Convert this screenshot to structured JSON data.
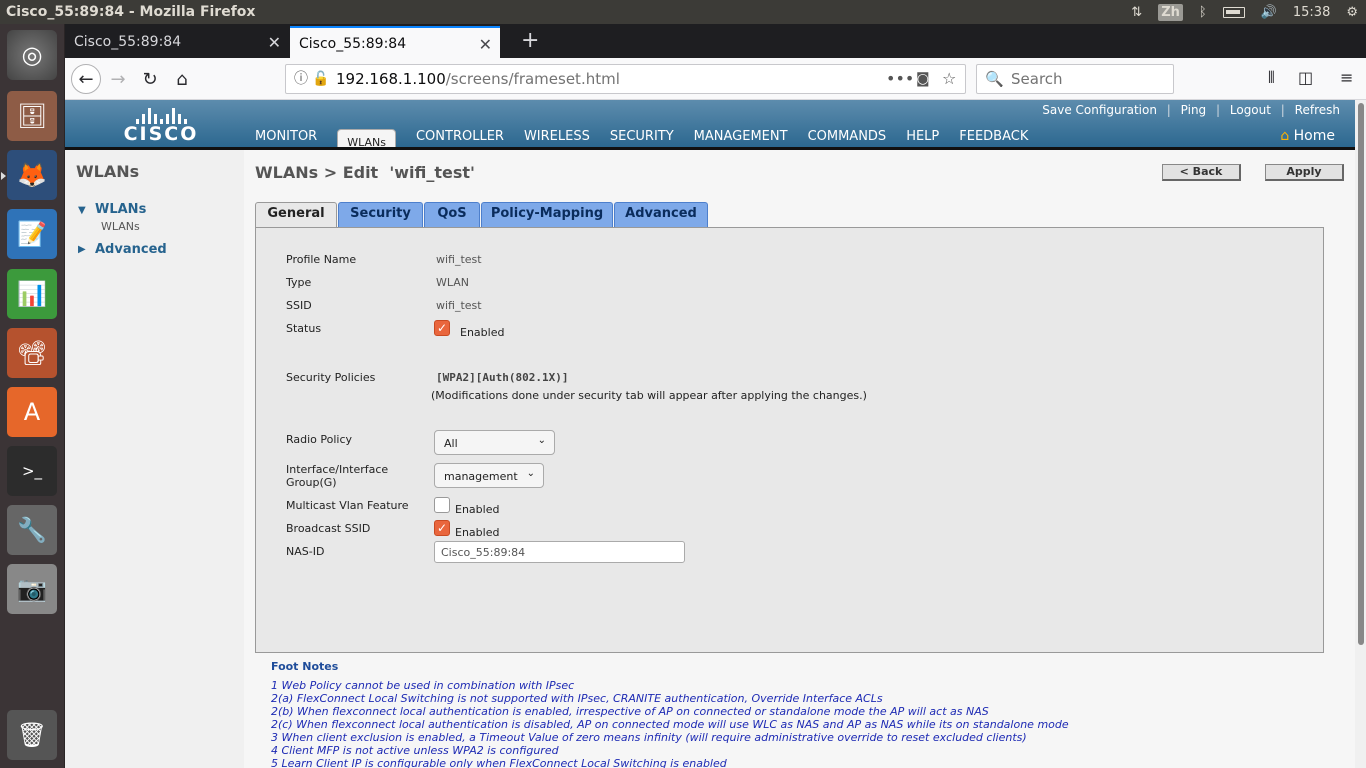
{
  "os_bar": {
    "title": "Cisco_55:89:84 - Mozilla Firefox",
    "ime": "Zh",
    "time": "15:38"
  },
  "launcher": {
    "items": [
      "ubuntu-dash",
      "files",
      "firefox",
      "writer",
      "calc",
      "impress",
      "software-center",
      "terminal",
      "system-settings",
      "screenshot",
      "trash"
    ]
  },
  "browser": {
    "tabs": [
      {
        "label": "Cisco_55:89:84"
      },
      {
        "label": "Cisco_55:89:84"
      }
    ],
    "url_host": "192.168.1.100",
    "url_path": "/screens/frameset.html",
    "search_placeholder": "Search"
  },
  "cisco": {
    "logo": "CISCO",
    "top_links": [
      "Save Configuration",
      "Ping",
      "Logout",
      "Refresh"
    ],
    "nav": [
      "MONITOR",
      "WLANs",
      "CONTROLLER",
      "WIRELESS",
      "SECURITY",
      "MANAGEMENT",
      "COMMANDS",
      "HELP",
      "FEEDBACK"
    ],
    "home": "Home"
  },
  "sidebar": {
    "title": "WLANs",
    "group1": "WLANs",
    "group1_sub": "WLANs",
    "group2": "Advanced"
  },
  "page": {
    "breadcrumb": "WLANs > Edit  'wifi_test'",
    "back": "< Back",
    "apply": "Apply",
    "tabs": [
      "General",
      "Security",
      "QoS",
      "Policy-Mapping",
      "Advanced"
    ]
  },
  "form": {
    "profile_name_label": "Profile Name",
    "profile_name": "wifi_test",
    "type_label": "Type",
    "type": "WLAN",
    "ssid_label": "SSID",
    "ssid": "wifi_test",
    "status_label": "Status",
    "status_text": "Enabled",
    "status_checked": true,
    "security_label": "Security Policies",
    "security_value": "[WPA2][Auth(802.1X)]",
    "security_note": "(Modifications done under security tab will appear after applying the changes.)",
    "radio_label": "Radio Policy",
    "radio_value": "All",
    "iface_label1": "Interface/Interface",
    "iface_label2": "Group(G)",
    "iface_value": "management",
    "multicast_label": "Multicast Vlan Feature",
    "multicast_text": "Enabled",
    "multicast_checked": false,
    "broadcast_label": "Broadcast SSID",
    "broadcast_text": "Enabled",
    "broadcast_checked": true,
    "nasid_label": "NAS-ID",
    "nasid_value": "Cisco_55:89:84"
  },
  "footnotes": {
    "title": "Foot Notes",
    "items": [
      "1 Web Policy cannot be used in combination with IPsec",
      "2(a) FlexConnect Local Switching is not supported with IPsec, CRANITE authentication, Override Interface ACLs",
      "2(b) When flexconnect local authentication is enabled, irrespective of AP on connected or standalone mode the AP will act as NAS",
      "2(c) When flexconnect local authentication is disabled, AP on connected mode will use WLC as NAS and AP as NAS while its on standalone mode",
      "3 When client exclusion is enabled, a Timeout Value of zero means infinity (will require administrative override to reset excluded clients)",
      "4 Client MFP is not active unless WPA2 is configured",
      "5 Learn Client IP is configurable only when FlexConnect Local Switching is enabled"
    ]
  }
}
